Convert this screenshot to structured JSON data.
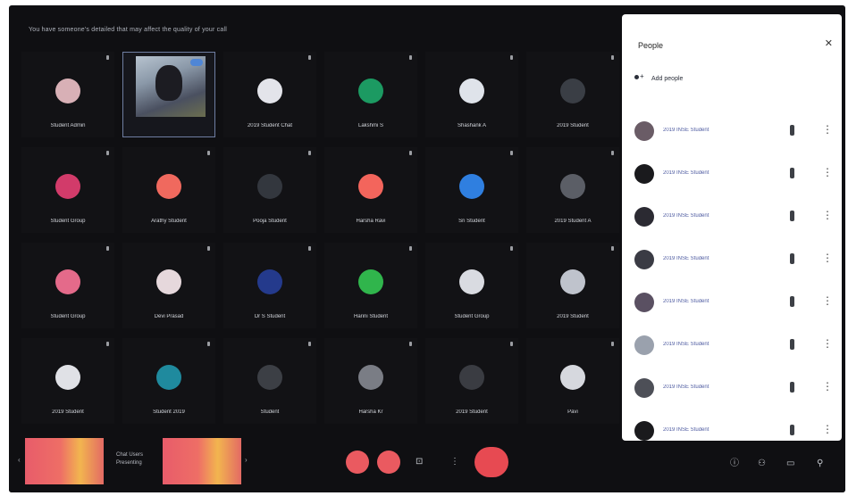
{
  "notice": "You have someone's detailed that may affect the quality of your call",
  "tiles": [
    {
      "name": "Student Admin",
      "avatar_color": "#d8b0b6"
    },
    {
      "name": "",
      "avatar_color": "",
      "active": true
    },
    {
      "name": "2019 Student Chat",
      "avatar_color": "#e3e4ea"
    },
    {
      "name": "Lakshmi S",
      "avatar_color": "#1c9a62"
    },
    {
      "name": "Shashank A",
      "avatar_color": "#dfe3ea"
    },
    {
      "name": "2019 Student",
      "avatar_color": "#3a3e45"
    },
    {
      "name": "Student Group",
      "avatar_color": "#d23b6a"
    },
    {
      "name": "Arathy Student",
      "avatar_color": "#f0695e"
    },
    {
      "name": "Pooja Student",
      "avatar_color": "#33373e"
    },
    {
      "name": "Harsha Ravi",
      "avatar_color": "#f3655c"
    },
    {
      "name": "Sri Student",
      "avatar_color": "#2f7fe0"
    },
    {
      "name": "2019 Student A",
      "avatar_color": "#5b5e66"
    },
    {
      "name": "Student Group",
      "avatar_color": "#e46a8a"
    },
    {
      "name": "Devi Prasad",
      "avatar_color": "#e6d8dc"
    },
    {
      "name": "Dr S Student",
      "avatar_color": "#243a8c"
    },
    {
      "name": "Harini Student",
      "avatar_color": "#30b54c"
    },
    {
      "name": "Student Group",
      "avatar_color": "#d9dbe1"
    },
    {
      "name": "2019 Student",
      "avatar_color": "#bfc3cc"
    },
    {
      "name": "2019 Student",
      "avatar_color": "#e0e1e6"
    },
    {
      "name": "Student 2019",
      "avatar_color": "#1f8a9e"
    },
    {
      "name": "Student",
      "avatar_color": "#3c3f45"
    },
    {
      "name": "Harsha Kr",
      "avatar_color": "#7a7d85"
    },
    {
      "name": "2019 Student",
      "avatar_color": "#3a3c42"
    },
    {
      "name": "Pavi",
      "avatar_color": "#d6d8de"
    }
  ],
  "bottom": {
    "presenter_line1": "Chat Users",
    "presenter_line2": "Presenting",
    "thumb_color_a": "#e85c6a",
    "thumb_color_b": "#f2b54f",
    "mic_color": "#ea5a60",
    "end_call_color": "#e74a52",
    "screen_icon": "present-icon",
    "info_icon": "info-icon",
    "people_icon": "people-icon",
    "chat_icon": "chat-icon",
    "activities_icon": "activities-icon"
  },
  "panel": {
    "title": "People",
    "close_icon": "close-icon",
    "add_label": "Add people",
    "participants": [
      {
        "name": "2019 INSE Student",
        "avatar_color": "#6a5c66"
      },
      {
        "name": "2019 INSE Student",
        "avatar_color": "#1a1a1d"
      },
      {
        "name": "2019 INSE Student",
        "avatar_color": "#2b2a32"
      },
      {
        "name": "2019 INSE Student",
        "avatar_color": "#3a3b44"
      },
      {
        "name": "2019 INSE Student",
        "avatar_color": "#5a5062"
      },
      {
        "name": "2019 INSE Student",
        "avatar_color": "#9aa1ad"
      },
      {
        "name": "2019 INSE Student",
        "avatar_color": "#4d4f57"
      },
      {
        "name": "2019 INSE Student",
        "avatar_color": "#1a1a1d"
      }
    ]
  }
}
